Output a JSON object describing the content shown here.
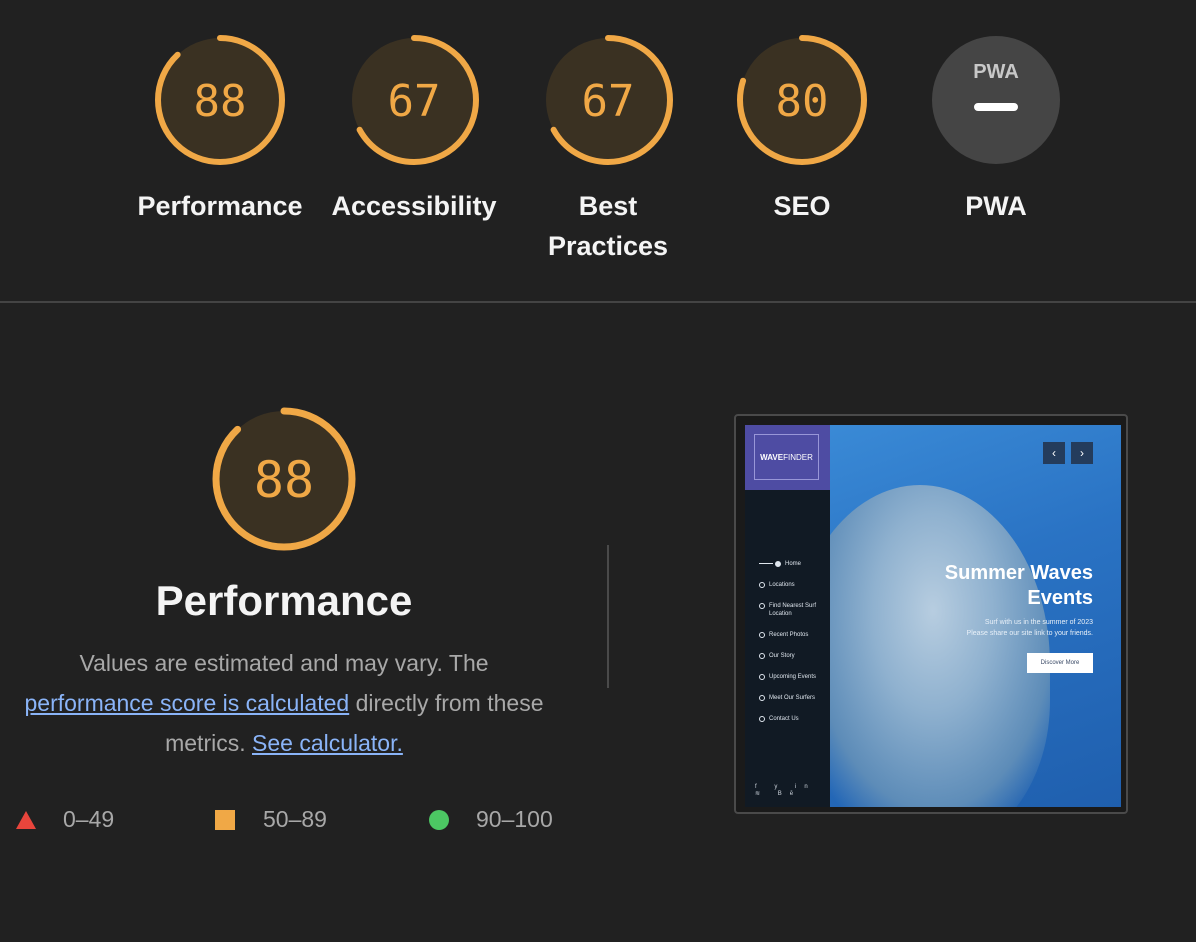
{
  "colors": {
    "average": "#f0a846",
    "fail": "#e8453c",
    "pass": "#4cc763",
    "link": "#8ab4f8",
    "na": "#454545"
  },
  "gauges": [
    {
      "label": "Performance",
      "score": "88",
      "fraction": 0.88,
      "type": "score"
    },
    {
      "label": "Accessibility",
      "score": "67",
      "fraction": 0.67,
      "type": "score"
    },
    {
      "label": "Best Practices",
      "score": "67",
      "fraction": 0.67,
      "type": "score"
    },
    {
      "label": "SEO",
      "score": "80",
      "fraction": 0.8,
      "type": "score"
    },
    {
      "label": "PWA",
      "badge": "PWA",
      "symbol": "—",
      "type": "pwa"
    }
  ],
  "performance": {
    "score": "88",
    "fraction": 0.88,
    "title": "Performance",
    "desc_prefix": "Values are estimated and may vary. The",
    "desc_link": "performance score is calculated",
    "desc_middle": "directly from these metrics.",
    "desc_link2": "See calculator."
  },
  "legend": [
    {
      "shape": "triangle-icon",
      "range": "0–49"
    },
    {
      "shape": "square-icon",
      "range": "50–89"
    },
    {
      "shape": "circle-icon",
      "range": "90–100"
    }
  ],
  "screenshot": {
    "logo_bold": "WAVE",
    "logo_light": "FINDER",
    "nav": [
      "Home",
      "Locations",
      "Find Nearest Surf Location",
      "Recent Photos",
      "Our Story",
      "Upcoming Events",
      "Meet Our Surfers",
      "Contact Us"
    ],
    "socials": "f y in ≋ Bē",
    "prev": "‹",
    "next": "›",
    "hero_title": "Summer Waves Events",
    "hero_sub1": "Surf with us in the summer of 2023",
    "hero_sub2": "Please share our site link to your friends.",
    "hero_button": "Discover More"
  }
}
